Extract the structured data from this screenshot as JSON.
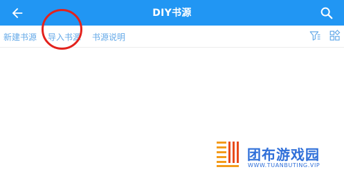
{
  "appbar": {
    "title": "DIY书源",
    "back_icon": "arrow-left-icon",
    "search_icon": "search-icon",
    "background": "#2196F3"
  },
  "toolbar": {
    "items": [
      {
        "label": "新建书源"
      },
      {
        "label": "导入书源"
      },
      {
        "label": "书源说明"
      }
    ],
    "filter_icon": "filter-icon",
    "grid_icon": "grid-icon",
    "link_color": "#64a9e8"
  },
  "annotation": {
    "highlight_color": "#e3221d"
  },
  "watermark": {
    "name": "团布游戏园",
    "url": "WWW.TUANBUTING.VIP"
  }
}
